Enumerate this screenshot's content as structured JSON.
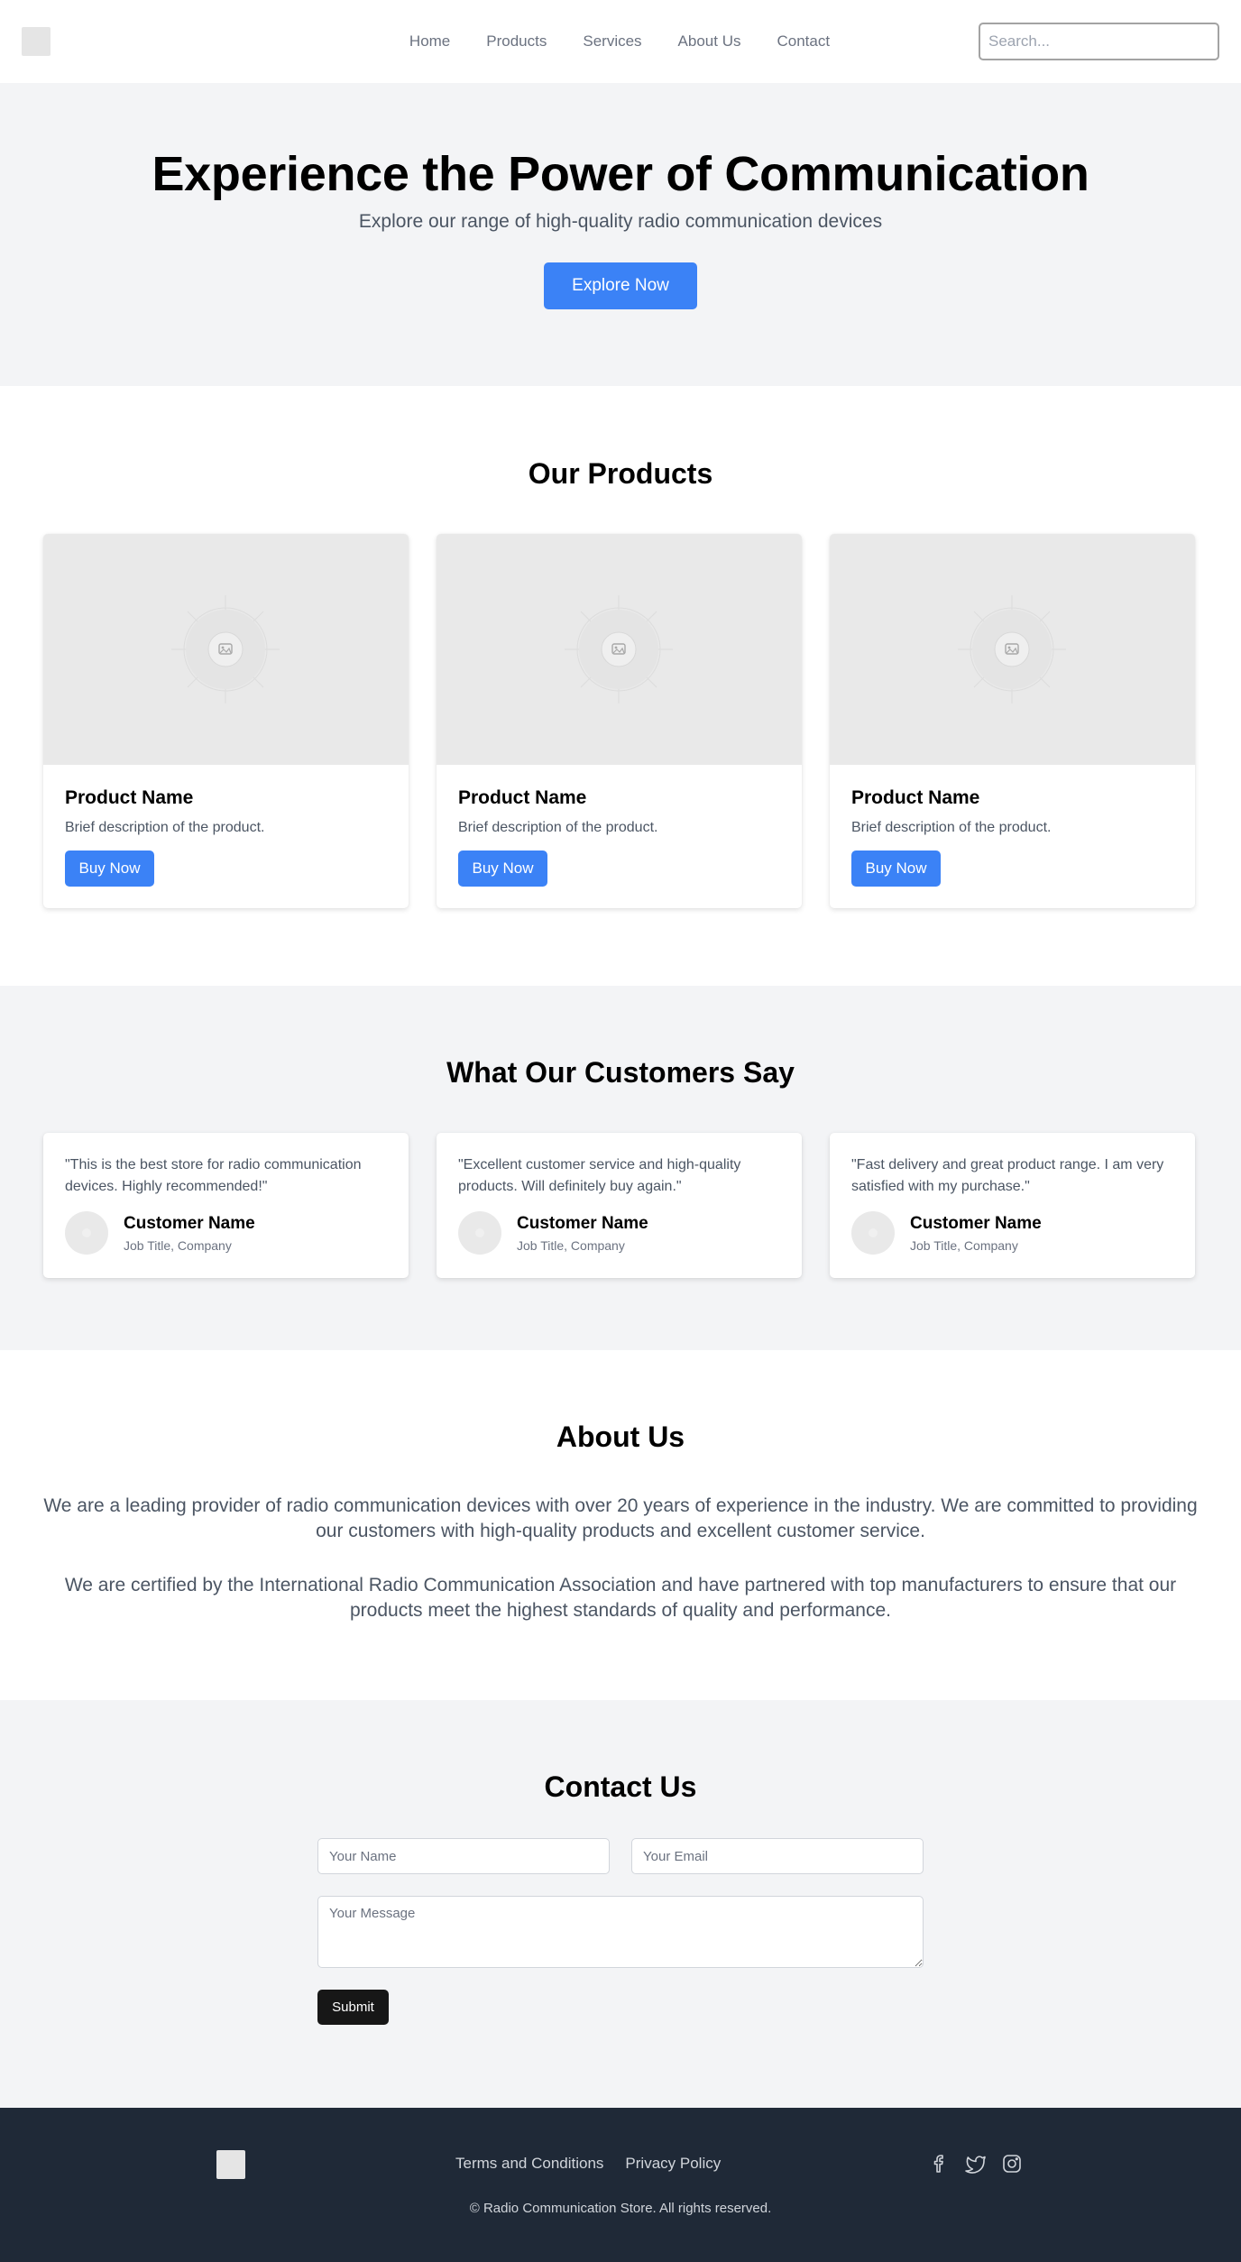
{
  "header": {
    "nav": [
      "Home",
      "Products",
      "Services",
      "About Us",
      "Contact"
    ],
    "search_placeholder": "Search..."
  },
  "hero": {
    "title": "Experience the Power of Communication",
    "subtitle": "Explore our range of high-quality radio communication devices",
    "cta": "Explore Now"
  },
  "products": {
    "title": "Our Products",
    "items": [
      {
        "name": "Product Name",
        "description": "Brief description of the product.",
        "button": "Buy Now"
      },
      {
        "name": "Product Name",
        "description": "Brief description of the product.",
        "button": "Buy Now"
      },
      {
        "name": "Product Name",
        "description": "Brief description of the product.",
        "button": "Buy Now"
      }
    ]
  },
  "testimonials": {
    "title": "What Our Customers Say",
    "items": [
      {
        "quote": "\"This is the best store for radio communication devices. Highly recommended!\"",
        "name": "Customer Name",
        "role": "Job Title, Company"
      },
      {
        "quote": "\"Excellent customer service and high-quality products. Will definitely buy again.\"",
        "name": "Customer Name",
        "role": "Job Title, Company"
      },
      {
        "quote": "\"Fast delivery and great product range. I am very satisfied with my purchase.\"",
        "name": "Customer Name",
        "role": "Job Title, Company"
      }
    ]
  },
  "about": {
    "title": "About Us",
    "paragraphs": [
      "We are a leading provider of radio communication devices with over 20 years of experience in the industry. We are committed to providing our customers with high-quality products and excellent customer service.",
      "We are certified by the International Radio Communication Association and have partnered with top manufacturers to ensure that our products meet the highest standards of quality and performance."
    ]
  },
  "contact": {
    "title": "Contact Us",
    "name_placeholder": "Your Name",
    "email_placeholder": "Your Email",
    "message_placeholder": "Your Message",
    "submit": "Submit"
  },
  "footer": {
    "links": [
      "Terms and Conditions",
      "Privacy Policy"
    ],
    "social": [
      "facebook-icon",
      "twitter-icon",
      "instagram-icon"
    ],
    "copyright": "© Radio Communication Store. All rights reserved."
  },
  "colors": {
    "accent": "#3b82f6",
    "section_bg": "#f3f4f6",
    "footer_bg": "#1f2937",
    "submit_bg": "#171717"
  }
}
